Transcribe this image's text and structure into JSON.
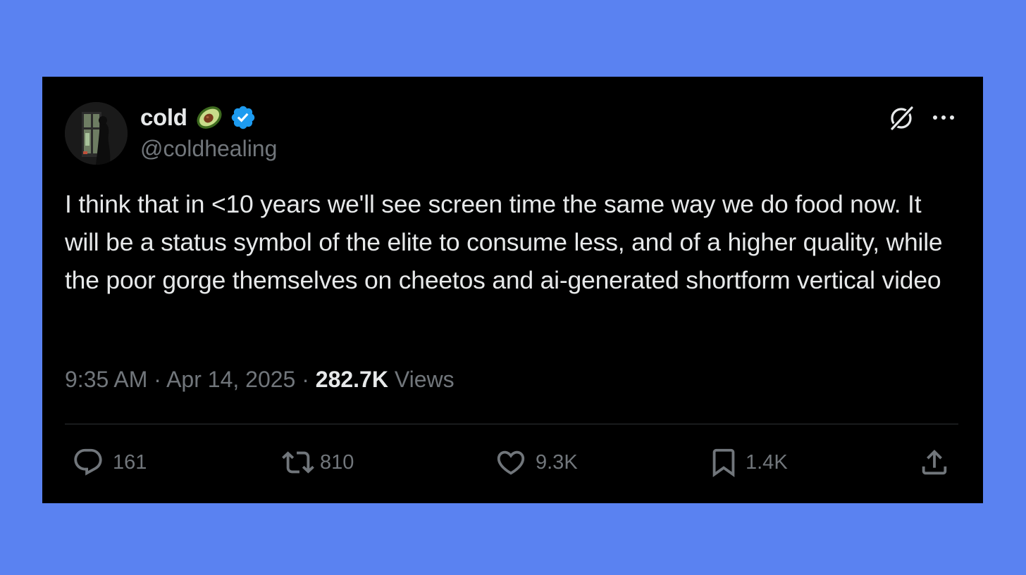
{
  "tweet": {
    "author": {
      "display_name": "cold",
      "emoji": "avocado",
      "verified": true,
      "handle": "@coldhealing"
    },
    "text": "I think that in <10 years we'll see screen time the same way we do food now. It will be a status symbol of the elite to consume less, and of a higher quality, while the poor gorge themselves on cheetos and ai-generated shortform vertical video",
    "time": "9:35 AM",
    "separator": "·",
    "date": "Apr 14, 2025",
    "views_count": "282.7K",
    "views_label": "Views",
    "actions": {
      "replies": "161",
      "reposts": "810",
      "likes": "9.3K",
      "bookmarks": "1.4K"
    }
  },
  "icons": {
    "grok": "grok-icon",
    "more": "more-options-icon",
    "reply": "reply-icon",
    "repost": "repost-icon",
    "like": "heart-icon",
    "bookmark": "bookmark-icon",
    "share": "share-icon"
  },
  "colors": {
    "background": "#5a82f1",
    "card": "#000000",
    "text_primary": "#e7e9ea",
    "text_secondary": "#71767b",
    "verified": "#1d9bf0",
    "divider": "#2f3336"
  }
}
